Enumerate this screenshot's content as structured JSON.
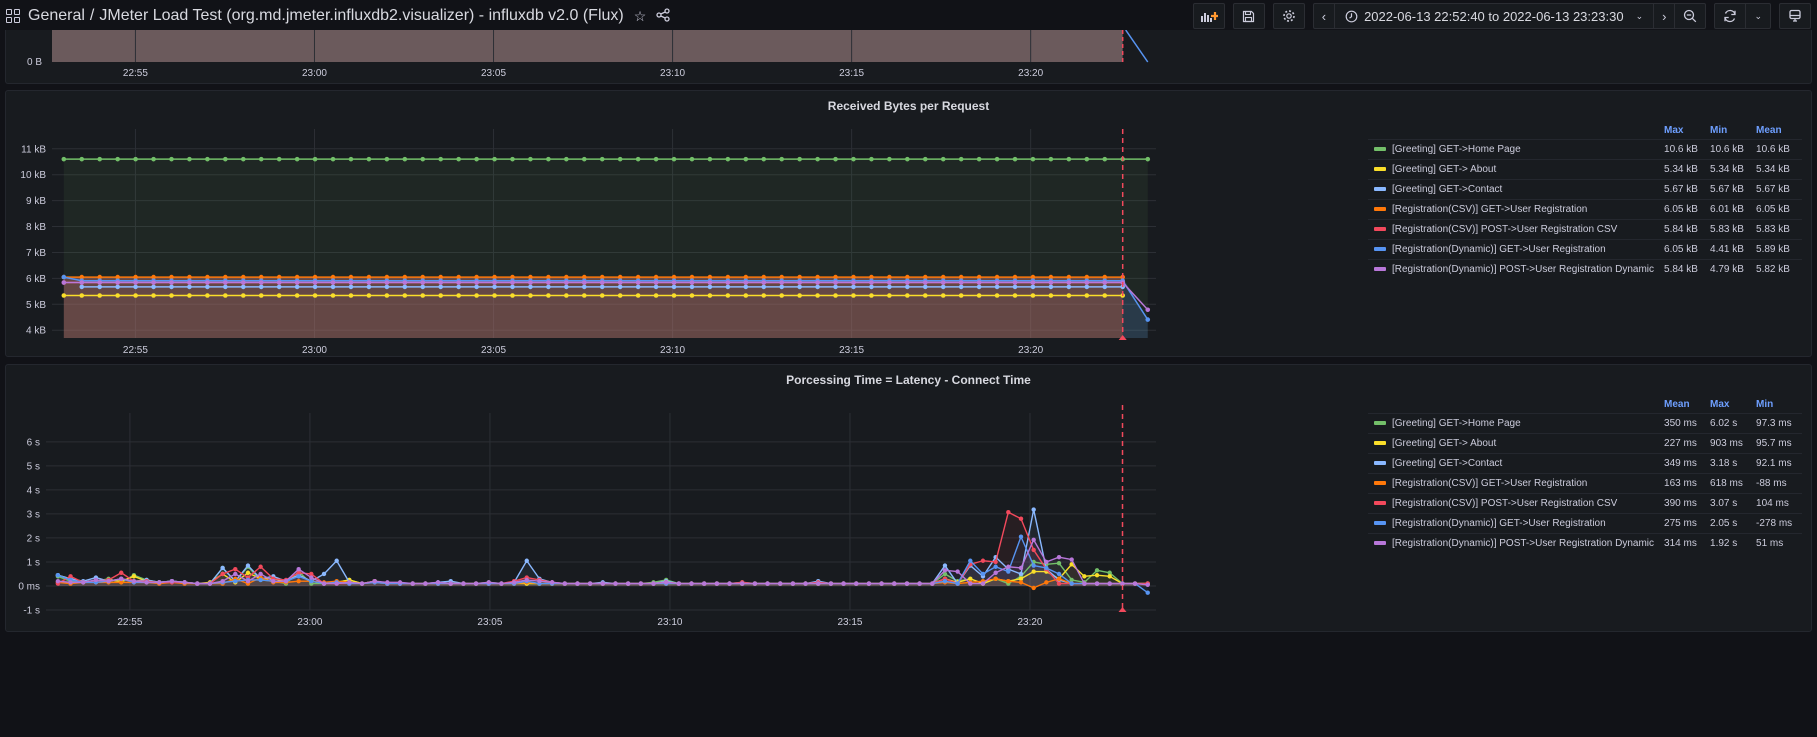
{
  "topbar": {
    "breadcrumb_folder": "General",
    "breadcrumb_separator": "/",
    "dashboard_title": "JMeter Load Test (org.md.jmeter.influxdb2.visualizer) - influxdb v2.0 (Flux)",
    "time_range": "2022-06-13 22:52:40 to 2022-06-13 23:23:30",
    "icons": [
      "apps-grid-icon",
      "star-icon",
      "share-icon",
      "add-panel-icon",
      "save-icon",
      "settings-icon",
      "chevron-left-icon",
      "clock-icon",
      "chevron-down-icon",
      "chevron-right-icon",
      "zoom-out-icon",
      "refresh-icon",
      "chevron-down-icon",
      "tv-mode-icon"
    ]
  },
  "colors": {
    "home": "#73bf69",
    "about": "#fade2a",
    "contact": "#8ab8ff",
    "csv_get": "#ff780a",
    "csv_post": "#f2495c",
    "dyn_get": "#5794f2",
    "dyn_post": "#b877d9",
    "annotation": "#f2495c"
  },
  "chart_data": [
    {
      "type": "area",
      "title": "",
      "partial": true,
      "yticks": [
        "0 B"
      ],
      "xticks": [
        "22:55",
        "23:00",
        "23:05",
        "23:10",
        "23:15",
        "23:20"
      ]
    },
    {
      "type": "line",
      "title": "Received Bytes per Request",
      "xlabel": "",
      "ylabel": "",
      "ylim": [
        3.7,
        11.3
      ],
      "yunit": "kB",
      "yticks": [
        "4 kB",
        "5 kB",
        "6 kB",
        "7 kB",
        "8 kB",
        "9 kB",
        "10 kB",
        "11 kB"
      ],
      "yticks_values": [
        4,
        5,
        6,
        7,
        8,
        9,
        10,
        11
      ],
      "xticks": [
        "22:55",
        "23:00",
        "23:05",
        "23:10",
        "23:15",
        "23:20"
      ],
      "xticks_minutes": [
        2.33,
        7.33,
        12.33,
        17.33,
        22.33,
        27.33
      ],
      "xrange_minutes": [
        0,
        30.83
      ],
      "annotation_minute": 29.9,
      "legend_columns": [
        "Max",
        "Min",
        "Mean"
      ],
      "series": [
        {
          "name": "[Greeting] GET->Home Page",
          "color": "#73bf69",
          "value": 10.6,
          "end": 10.6,
          "stats": [
            "10.6 kB",
            "10.6 kB",
            "10.6 kB"
          ]
        },
        {
          "name": "[Greeting] GET-> About",
          "color": "#fade2a",
          "value": 5.34,
          "end": null,
          "stats": [
            "5.34 kB",
            "5.34 kB",
            "5.34 kB"
          ]
        },
        {
          "name": "[Greeting] GET->Contact",
          "color": "#8ab8ff",
          "value": 5.67,
          "end": null,
          "stats": [
            "5.67 kB",
            "5.67 kB",
            "5.67 kB"
          ]
        },
        {
          "name": "[Registration(CSV)] GET->User Registration",
          "color": "#ff780a",
          "value": 6.05,
          "end": null,
          "stats": [
            "6.05 kB",
            "6.01 kB",
            "6.05 kB"
          ]
        },
        {
          "name": "[Registration(CSV)] POST->User Registration CSV",
          "color": "#f2495c",
          "value": 5.84,
          "end": null,
          "stats": [
            "5.84 kB",
            "5.83 kB",
            "5.83 kB"
          ]
        },
        {
          "name": "[Registration(Dynamic)] GET->User Registration",
          "color": "#5794f2",
          "value": 5.91,
          "end": 4.41,
          "stats": [
            "6.05 kB",
            "4.41 kB",
            "5.89 kB"
          ]
        },
        {
          "name": "[Registration(Dynamic)] POST->User Registration Dynamic",
          "color": "#b877d9",
          "value": 5.84,
          "end": 4.79,
          "stats": [
            "5.84 kB",
            "4.79 kB",
            "5.82 kB"
          ]
        }
      ]
    },
    {
      "type": "line",
      "title": "Porcessing Time = Latency - Connect Time",
      "xlabel": "",
      "ylabel": "",
      "ylim": [
        -1,
        6.7
      ],
      "yunit": "s",
      "yticks": [
        "-1 s",
        "0 ms",
        "1 s",
        "2 s",
        "3 s",
        "4 s",
        "5 s",
        "6 s"
      ],
      "yticks_values": [
        -1,
        0,
        1,
        2,
        3,
        4,
        5,
        6
      ],
      "xticks": [
        "22:55",
        "23:00",
        "23:05",
        "23:10",
        "23:15",
        "23:20"
      ],
      "xticks_minutes": [
        2.33,
        7.33,
        12.33,
        17.33,
        22.33,
        27.33
      ],
      "xrange_minutes": [
        0,
        30.83
      ],
      "annotation_minute": 29.9,
      "legend_columns": [
        "Mean",
        "Max",
        "Min"
      ],
      "series": [
        {
          "name": "[Greeting] GET->Home Page",
          "color": "#73bf69",
          "stats": [
            "350 ms",
            "6.02 s",
            "97.3 ms"
          ],
          "values": [
            0.4,
            0.2,
            0.15,
            0.2,
            0.3,
            0.15,
            0.45,
            0.25,
            0.15,
            0.2,
            0.15,
            0.1,
            0.1,
            0.75,
            0.2,
            0.8,
            0.25,
            0.2,
            0.1,
            0.6,
            0.1,
            0.1,
            0.15,
            0.25,
            0.1,
            0.15,
            0.1,
            0.1,
            0.1,
            0.1,
            0.1,
            0.1,
            0.1,
            0.1,
            0.15,
            0.1,
            0.15,
            0.1,
            0.1,
            0.1,
            0.1,
            0.1,
            0.1,
            0.1,
            0.1,
            0.1,
            0.1,
            0.15,
            0.25,
            0.1,
            0.1,
            0.1,
            0.1,
            0.1,
            0.15,
            0.1,
            0.1,
            0.1,
            0.1,
            0.1,
            0.1,
            0.1,
            0.1,
            0.1,
            0.1,
            0.1,
            0.1,
            0.1,
            0.1,
            0.1,
            0.5,
            0.2,
            0.3,
            0.1,
            0.3,
            0.1,
            0.4,
            1.0,
            0.9,
            0.95,
            0.25,
            0.15,
            0.65,
            0.55,
            0.1,
            0.1,
            0.1
          ]
        },
        {
          "name": "[Greeting] GET-> About",
          "color": "#fade2a",
          "stats": [
            "227 ms",
            "903 ms",
            "95.7 ms"
          ],
          "values": [
            0.45,
            0.3,
            0.15,
            0.2,
            0.25,
            0.2,
            0.4,
            0.2,
            0.15,
            0.2,
            0.15,
            0.1,
            0.15,
            0.5,
            0.15,
            0.55,
            0.3,
            0.3,
            0.2,
            0.45,
            0.2,
            0.1,
            0.15,
            0.25,
            0.1,
            0.2,
            0.1,
            0.1,
            0.1,
            0.1,
            0.1,
            0.1,
            0.1,
            0.1,
            0.1,
            0.1,
            0.1,
            0.1,
            0.1,
            0.1,
            0.1,
            0.1,
            0.1,
            0.1,
            0.1,
            0.1,
            0.1,
            0.1,
            0.1,
            0.1,
            0.1,
            0.1,
            0.1,
            0.1,
            0.1,
            0.1,
            0.1,
            0.1,
            0.1,
            0.1,
            0.1,
            0.1,
            0.1,
            0.1,
            0.1,
            0.1,
            0.1,
            0.1,
            0.1,
            0.1,
            0.3,
            0.15,
            0.3,
            0.1,
            0.3,
            0.2,
            0.3,
            0.6,
            0.6,
            0.3,
            0.9,
            0.4,
            0.45,
            0.4,
            0.1,
            0.1,
            0.1
          ]
        },
        {
          "name": "[Greeting] GET->Contact",
          "color": "#8ab8ff",
          "stats": [
            "349 ms",
            "3.18 s",
            "92.1 ms"
          ],
          "values": [
            0.45,
            0.3,
            0.2,
            0.35,
            0.2,
            0.3,
            0.2,
            0.25,
            0.15,
            0.2,
            0.15,
            0.1,
            0.1,
            0.75,
            0.2,
            0.85,
            0.3,
            0.4,
            0.2,
            0.45,
            0.2,
            0.5,
            1.05,
            0.15,
            0.1,
            0.2,
            0.1,
            0.1,
            0.1,
            0.1,
            0.15,
            0.2,
            0.1,
            0.1,
            0.1,
            0.1,
            0.15,
            1.05,
            0.3,
            0.15,
            0.1,
            0.1,
            0.1,
            0.15,
            0.1,
            0.1,
            0.1,
            0.1,
            0.2,
            0.1,
            0.1,
            0.1,
            0.1,
            0.1,
            0.1,
            0.1,
            0.1,
            0.1,
            0.1,
            0.1,
            0.2,
            0.1,
            0.1,
            0.1,
            0.1,
            0.1,
            0.1,
            0.1,
            0.1,
            0.1,
            0.85,
            0.1,
            0.85,
            0.4,
            1.2,
            0.7,
            0.5,
            3.18,
            0.7,
            0.25,
            0.1,
            0.1,
            0.1,
            0.1,
            0.1,
            0.1,
            0.1
          ]
        },
        {
          "name": "[Registration(CSV)] GET->User Registration",
          "color": "#ff780a",
          "stats": [
            "163 ms",
            "618 ms",
            "-88 ms"
          ],
          "values": [
            0.15,
            0.1,
            0.15,
            0.15,
            0.15,
            0.15,
            0.15,
            0.15,
            0.1,
            0.15,
            0.1,
            0.1,
            0.1,
            0.1,
            0.3,
            0.1,
            0.35,
            0.15,
            0.15,
            0.2,
            0.2,
            0.15,
            0.2,
            0.15,
            0.1,
            0.2,
            0.1,
            0.1,
            0.1,
            0.1,
            0.1,
            0.1,
            0.1,
            0.1,
            0.1,
            0.1,
            0.1,
            0.15,
            0.1,
            0.1,
            0.1,
            0.1,
            0.1,
            0.1,
            0.1,
            0.1,
            0.1,
            0.1,
            0.15,
            0.1,
            0.1,
            0.1,
            0.1,
            0.1,
            0.1,
            0.1,
            0.1,
            0.1,
            0.1,
            0.1,
            0.1,
            0.1,
            0.1,
            0.1,
            0.1,
            0.1,
            0.1,
            0.1,
            0.1,
            0.1,
            0.15,
            0.1,
            0.15,
            0.2,
            0.3,
            0.2,
            0.15,
            -0.08,
            0.15,
            0.3,
            0.1,
            0.1,
            0.1,
            0.1,
            0.1,
            0.1,
            0.1
          ]
        },
        {
          "name": "[Registration(CSV)] POST->User Registration CSV",
          "color": "#f2495c",
          "stats": [
            "390 ms",
            "3.07 s",
            "104 ms"
          ],
          "values": [
            0.1,
            0.4,
            0.15,
            0.2,
            0.25,
            0.55,
            0.2,
            0.2,
            0.15,
            0.15,
            0.15,
            0.1,
            0.1,
            0.5,
            0.7,
            0.35,
            0.8,
            0.3,
            0.25,
            0.55,
            0.5,
            0.1,
            0.1,
            0.1,
            0.1,
            0.15,
            0.1,
            0.1,
            0.1,
            0.1,
            0.1,
            0.1,
            0.1,
            0.1,
            0.1,
            0.1,
            0.2,
            0.35,
            0.25,
            0.15,
            0.1,
            0.1,
            0.1,
            0.1,
            0.1,
            0.1,
            0.1,
            0.1,
            0.15,
            0.1,
            0.1,
            0.1,
            0.1,
            0.1,
            0.15,
            0.1,
            0.1,
            0.1,
            0.1,
            0.1,
            0.15,
            0.1,
            0.1,
            0.1,
            0.1,
            0.1,
            0.1,
            0.1,
            0.1,
            0.1,
            0.3,
            0.1,
            0.9,
            1.05,
            1.0,
            3.07,
            2.8,
            1.5,
            0.7,
            0.1,
            0.1,
            0.1,
            0.1,
            0.1,
            0.1,
            0.1,
            0.1
          ]
        },
        {
          "name": "[Registration(Dynamic)] GET->User Registration",
          "color": "#5794f2",
          "stats": [
            "275 ms",
            "2.05 s",
            "-278 ms"
          ],
          "values": [
            0.45,
            0.25,
            0.15,
            0.15,
            0.2,
            0.3,
            0.15,
            0.15,
            0.15,
            0.2,
            0.15,
            0.1,
            0.1,
            0.15,
            0.2,
            0.25,
            0.25,
            0.2,
            0.2,
            0.4,
            0.2,
            0.1,
            0.15,
            0.1,
            0.1,
            0.15,
            0.1,
            0.1,
            0.1,
            0.1,
            0.1,
            0.1,
            0.1,
            0.1,
            0.1,
            0.1,
            0.1,
            0.2,
            0.1,
            0.1,
            0.1,
            0.1,
            0.1,
            0.1,
            0.1,
            0.1,
            0.1,
            0.1,
            0.1,
            0.1,
            0.1,
            0.1,
            0.1,
            0.1,
            0.1,
            0.1,
            0.1,
            0.1,
            0.1,
            0.1,
            0.1,
            0.1,
            0.1,
            0.1,
            0.1,
            0.1,
            0.1,
            0.1,
            0.1,
            0.1,
            0.2,
            0.1,
            1.05,
            0.5,
            0.8,
            0.6,
            2.05,
            0.85,
            0.75,
            0.5,
            0.1,
            0.1,
            0.1,
            0.1,
            0.1,
            0.1,
            -0.28
          ]
        },
        {
          "name": "[Registration(Dynamic)] POST->User Registration Dynamic",
          "color": "#b877d9",
          "stats": [
            "314 ms",
            "1.92 s",
            "51 ms"
          ],
          "values": [
            0.2,
            0.15,
            0.15,
            0.25,
            0.2,
            0.3,
            0.2,
            0.15,
            0.15,
            0.2,
            0.15,
            0.1,
            0.1,
            0.2,
            0.5,
            0.2,
            0.5,
            0.2,
            0.2,
            0.7,
            0.35,
            0.1,
            0.1,
            0.15,
            0.1,
            0.2,
            0.15,
            0.15,
            0.1,
            0.1,
            0.15,
            0.1,
            0.1,
            0.1,
            0.15,
            0.1,
            0.15,
            0.25,
            0.2,
            0.15,
            0.1,
            0.1,
            0.1,
            0.1,
            0.1,
            0.1,
            0.1,
            0.1,
            0.15,
            0.1,
            0.1,
            0.1,
            0.1,
            0.1,
            0.1,
            0.1,
            0.1,
            0.1,
            0.1,
            0.1,
            0.1,
            0.1,
            0.1,
            0.1,
            0.1,
            0.1,
            0.1,
            0.1,
            0.1,
            0.1,
            0.65,
            0.6,
            0.1,
            0.1,
            0.55,
            0.8,
            0.75,
            1.92,
            1.0,
            1.2,
            1.1,
            0.1,
            0.1,
            0.1,
            0.1,
            0.1,
            0.05
          ]
        }
      ]
    }
  ]
}
